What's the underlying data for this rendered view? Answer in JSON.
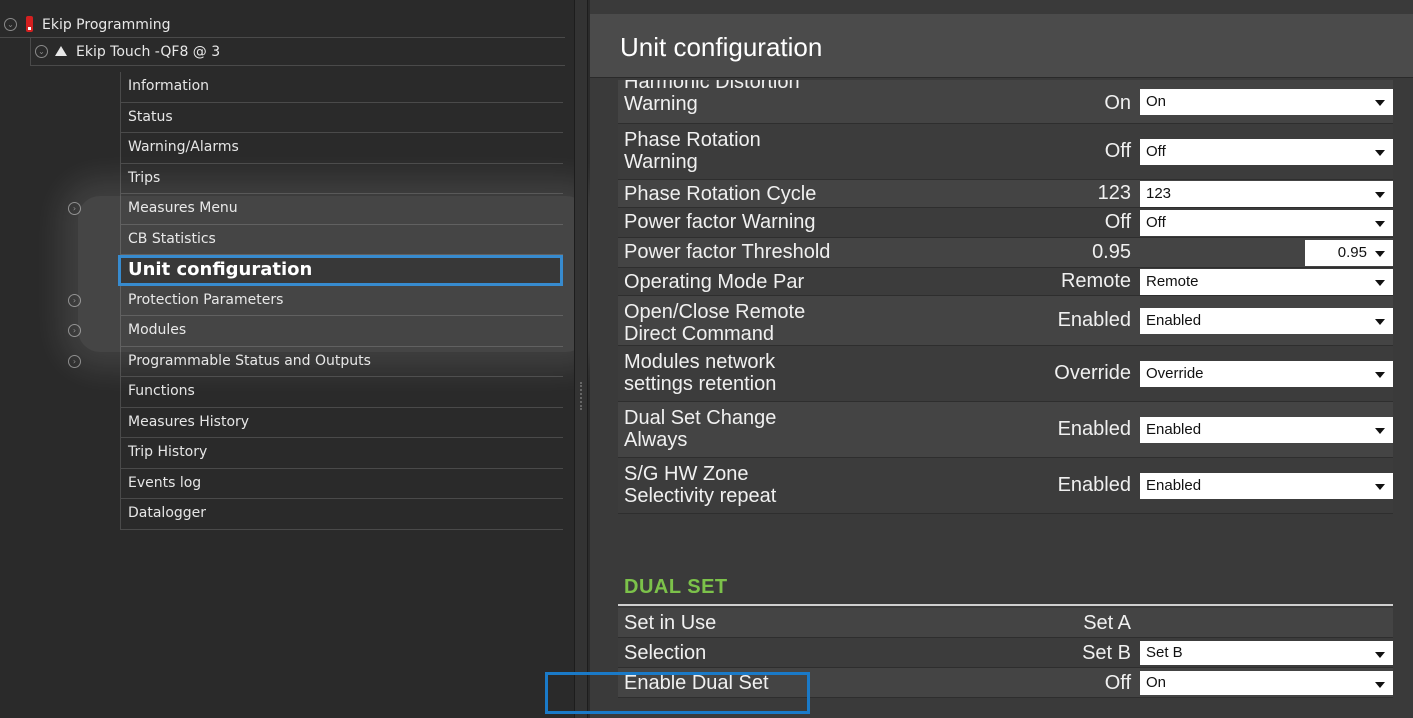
{
  "tree": {
    "root_label": "Ekip Programming",
    "device_label": "Ekip Touch -QF8 @ 3",
    "items": [
      {
        "label": "Information",
        "expander": false
      },
      {
        "label": "Status",
        "expander": false
      },
      {
        "label": "Warning/Alarms",
        "expander": false
      },
      {
        "label": "Trips",
        "expander": false
      },
      {
        "label": "Measures Menu",
        "expander": true
      },
      {
        "label": "CB Statistics",
        "expander": false
      },
      {
        "label": "Unit configuration",
        "expander": false,
        "selected": true
      },
      {
        "label": "Protection Parameters",
        "expander": true
      },
      {
        "label": "Modules",
        "expander": true
      },
      {
        "label": "Programmable Status and Outputs",
        "expander": true
      },
      {
        "label": "Functions",
        "expander": false
      },
      {
        "label": "Measures History",
        "expander": false
      },
      {
        "label": "Trip History",
        "expander": false
      },
      {
        "label": "Events log",
        "expander": false
      },
      {
        "label": "Datalogger",
        "expander": false
      }
    ]
  },
  "panel": {
    "title": "Unit configuration",
    "rows": [
      {
        "label_line1": "Harmonic Distortion",
        "label_line2": "Warning",
        "value": "On",
        "select": "On"
      },
      {
        "label_line1": "Phase Rotation",
        "label_line2": "Warning",
        "value": "Off",
        "select": "Off"
      },
      {
        "label_line1": "Phase Rotation Cycle",
        "label_line2": "",
        "value": "123",
        "select": "123"
      },
      {
        "label_line1": "Power factor Warning",
        "label_line2": "",
        "value": "Off",
        "select": "Off"
      },
      {
        "label_line1": "Power factor Threshold",
        "label_line2": "",
        "value": "0.95",
        "select": "0.95"
      },
      {
        "label_line1": "Operating Mode Par",
        "label_line2": "",
        "value": "Remote",
        "select": "Remote"
      },
      {
        "label_line1": "Open/Close Remote",
        "label_line2": "Direct Command",
        "value": "Enabled",
        "select": "Enabled"
      },
      {
        "label_line1": "Modules network",
        "label_line2": "settings retention",
        "value": "Override",
        "select": "Override"
      },
      {
        "label_line1": "Dual Set Change",
        "label_line2": "Always",
        "value": "Enabled",
        "select": "Enabled"
      },
      {
        "label_line1": "S/G HW Zone",
        "label_line2": "Selectivity repeat",
        "value": "Enabled",
        "select": "Enabled"
      }
    ],
    "section": "DUAL SET",
    "dual_rows": [
      {
        "label": "Set in Use",
        "value": "Set A",
        "select": ""
      },
      {
        "label": "Selection",
        "value": "Set B",
        "select": "Set B"
      },
      {
        "label": "Enable Dual Set",
        "value": "Off",
        "select": "On"
      }
    ]
  },
  "colors": {
    "accent_blue": "#1a7ac8",
    "section_green": "#7cc24a",
    "alert_red": "#d42020"
  },
  "icons": [
    "collapse-circle-icon",
    "alert-red-icon",
    "warning-triangle-icon",
    "expand-circle-icon",
    "dropdown-caret-icon"
  ]
}
